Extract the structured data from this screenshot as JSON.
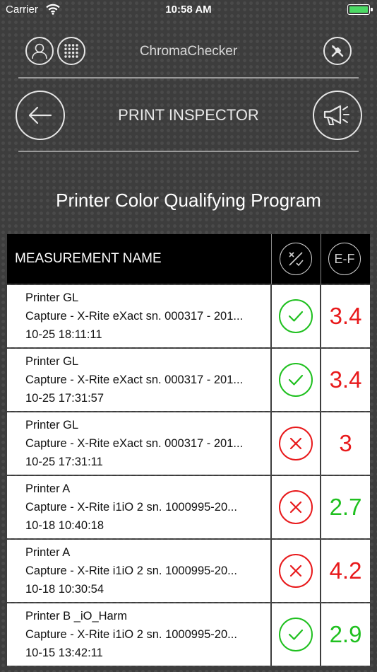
{
  "status_bar": {
    "carrier": "Carrier",
    "time": "10:58 AM",
    "icons": [
      "wifi-icon",
      "battery-icon"
    ]
  },
  "header": {
    "app_name": "ChromaChecker",
    "page_title": "PRINT INSPECTOR",
    "icons": [
      "user-icon",
      "grid-menu-icon",
      "tools-icon",
      "back-arrow-icon",
      "megaphone-icon"
    ]
  },
  "program_title": "Printer Color Qualifying Program",
  "table": {
    "header": {
      "name": "MEASUREMENT NAME",
      "status_icon": "tolerance-icon",
      "value_icon": "e-f-icon",
      "value_icon_text": "E-F"
    },
    "rows": [
      {
        "printer": "Printer GL",
        "capture": "Capture - X-Rite eXact sn. 000317 - 201...",
        "datetime": "10-25 18:11:11",
        "status": "pass",
        "value": "3.4",
        "value_color": "#e8191b"
      },
      {
        "printer": "Printer GL",
        "capture": "Capture - X-Rite eXact sn. 000317 - 201...",
        "datetime": "10-25 17:31:57",
        "status": "pass",
        "value": "3.4",
        "value_color": "#e8191b"
      },
      {
        "printer": "Printer GL",
        "capture": "Capture - X-Rite eXact sn. 000317 - 201...",
        "datetime": "10-25 17:31:11",
        "status": "fail",
        "value": "3",
        "value_color": "#e8191b"
      },
      {
        "printer": "Printer A",
        "capture": "Capture - X-Rite i1iO 2 sn. 1000995-20...",
        "datetime": "10-18 10:40:18",
        "status": "fail",
        "value": "2.7",
        "value_color": "#1fc01f"
      },
      {
        "printer": "Printer A",
        "capture": "Capture - X-Rite i1iO 2 sn. 1000995-20...",
        "datetime": "10-18 10:30:54",
        "status": "fail",
        "value": "4.2",
        "value_color": "#e8191b"
      },
      {
        "printer": "Printer B _iO_Harm",
        "capture": "Capture - X-Rite i1iO 2 sn. 1000995-20...",
        "datetime": "10-15 13:42:11",
        "status": "pass",
        "value": "2.9",
        "value_color": "#1fc01f"
      }
    ]
  },
  "colors": {
    "pass": "#1fc01f",
    "fail": "#e8191b",
    "battery": "#4cd964",
    "background": "#3d3d3d"
  }
}
